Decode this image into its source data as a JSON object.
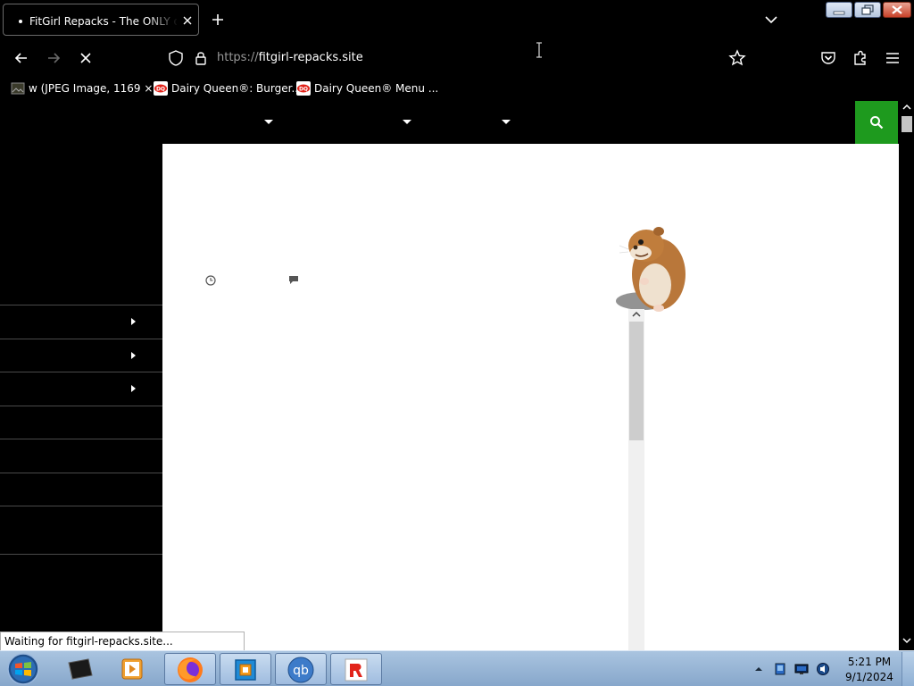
{
  "browser": {
    "tab": {
      "title": "FitGirl Repacks - The ONLY official site"
    },
    "address": {
      "scheme": "https://",
      "host": "fitgirl-repacks.site"
    },
    "bookmarks": [
      {
        "label": "w (JPEG Image, 1169 ×..."
      },
      {
        "label": "Dairy Queen®: Burger..."
      },
      {
        "label": "Dairy Queen® Menu ..."
      }
    ],
    "status": "Waiting for fitgirl-repacks.site..."
  },
  "colors": {
    "search_button": "#1e9a1e",
    "page_background": "#ffffff",
    "chrome_background": "#000000"
  },
  "icons": {
    "back": "arrow-left",
    "forward": "arrow-right",
    "stop": "x",
    "shield": "tracking-protection",
    "lock": "padlock",
    "bookmark_star": "star",
    "pocket": "pocket",
    "extensions": "puzzle",
    "menu": "hamburger",
    "search": "magnifier",
    "post_date": "clock",
    "post_comments": "speech-bubble"
  },
  "taskbar": {
    "apps": [
      "windows-explorer",
      "media-player",
      "firefox",
      "virtualbox",
      "qbittorrent",
      "roblox"
    ],
    "time": "5:21 PM",
    "date": "9/1/2024"
  }
}
